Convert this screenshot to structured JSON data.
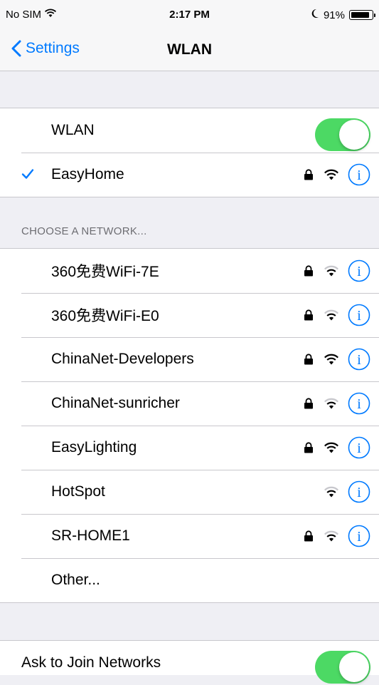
{
  "status_bar": {
    "carrier": "No SIM",
    "time": "2:17 PM",
    "battery": "91%",
    "battery_level": 0.91
  },
  "nav": {
    "back_label": "Settings",
    "title": "WLAN"
  },
  "wlan_toggle": {
    "label": "WLAN",
    "on": true
  },
  "connected": {
    "name": "EasyHome",
    "locked": true,
    "signal": 3
  },
  "section_header": "CHOOSE A NETWORK...",
  "networks": [
    {
      "name": "360免费WiFi-7E",
      "locked": true,
      "signal": 2
    },
    {
      "name": "360免费WiFi-E0",
      "locked": true,
      "signal": 2
    },
    {
      "name": "ChinaNet-Developers",
      "locked": true,
      "signal": 3
    },
    {
      "name": "ChinaNet-sunricher",
      "locked": true,
      "signal": 2
    },
    {
      "name": "EasyLighting",
      "locked": true,
      "signal": 3
    },
    {
      "name": "HotSpot",
      "locked": false,
      "signal": 2
    },
    {
      "name": "SR-HOME1",
      "locked": true,
      "signal": 2
    }
  ],
  "other_label": "Other...",
  "ask_to_join": {
    "label": "Ask to Join Networks",
    "on": true
  },
  "colors": {
    "accent": "#007aff",
    "toggle_on": "#4cd964",
    "background": "#efeff4",
    "separator": "#c8c7cc",
    "section_text": "#6d6d72"
  }
}
